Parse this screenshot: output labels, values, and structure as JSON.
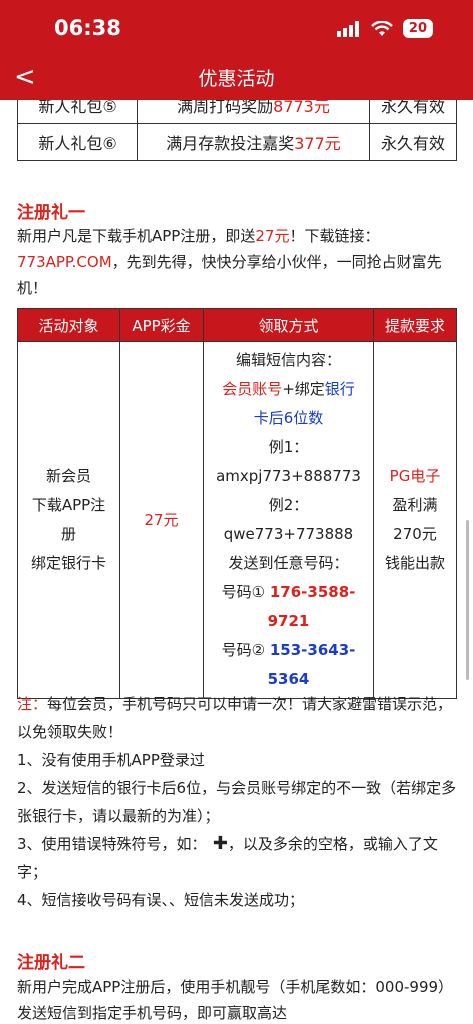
{
  "status": {
    "time": "06:38",
    "battery": "20"
  },
  "nav": {
    "back": "<",
    "title": "优惠活动"
  },
  "top_table": [
    {
      "name": "新人礼包⑤",
      "desc_pre": "满周打码奖励",
      "amount": "8773元",
      "period": "永久有效"
    },
    {
      "name": "新人礼包⑥",
      "desc_pre": "满月存款投注嘉奖",
      "amount": "377元",
      "period": "永久有效"
    }
  ],
  "section1": {
    "title": "注册礼一",
    "intro_pre": "新用户凡是下载手机APP注册，即送",
    "intro_amount": "27元",
    "intro_mid": "！下载链接：",
    "intro_link": "773APP.COM",
    "intro_post": "，先到先得，快快分享给小伙伴，一同抢占财富先机！"
  },
  "table2": {
    "headers": [
      "活动对象",
      "APP彩金",
      "领取方式",
      "提款要求"
    ],
    "target_lines": [
      "新会员",
      "下载APP注",
      "册",
      "绑定银行卡"
    ],
    "bonus": "27元",
    "method": {
      "l1": "编辑短信内容：",
      "l2_red": "会员账号",
      "l2_plus": "+绑定",
      "l2_blue": "银行",
      "l3_blue": "卡后6位数",
      "l4": "例1：",
      "l5": "amxpj773+888773",
      "l6": "例2：",
      "l7": "qwe773+773888",
      "l8": "发送到任意号码：",
      "n1_label": "号码①",
      "n1_a": "176-3588-",
      "n1_b": "9721",
      "n2_label": "号码②",
      "n2_a": "153-3643-",
      "n2_b": "5364"
    },
    "withdraw": {
      "l1": "PG电子",
      "l2": "盈利满",
      "l3": "270元",
      "l4": "钱能出款"
    }
  },
  "notes": {
    "label": "注：",
    "intro": "每位会员，手机号码只可以申请一次！请大家避雷错误示范，以免领取失败！",
    "items": [
      "1、没有使用手机APP登录过",
      "2、发送短信的银行卡后6位，与会员账号绑定的不一致（若绑定多张银行卡，请以最新的为准）；",
      "3、使用错误特殊符号，如：",
      "4、短信接收号码有误、、短信未发送成功；"
    ],
    "item3_post": "，以及多余的空格，或输入了文字；",
    "plus_icon": "heavy-plus-icon"
  },
  "section2": {
    "title": "注册礼二",
    "text": "新用户完成APP注册后，使用手机靓号（手机尾数如：000-999）发送短信到指定手机号码，即可赢取高达"
  }
}
